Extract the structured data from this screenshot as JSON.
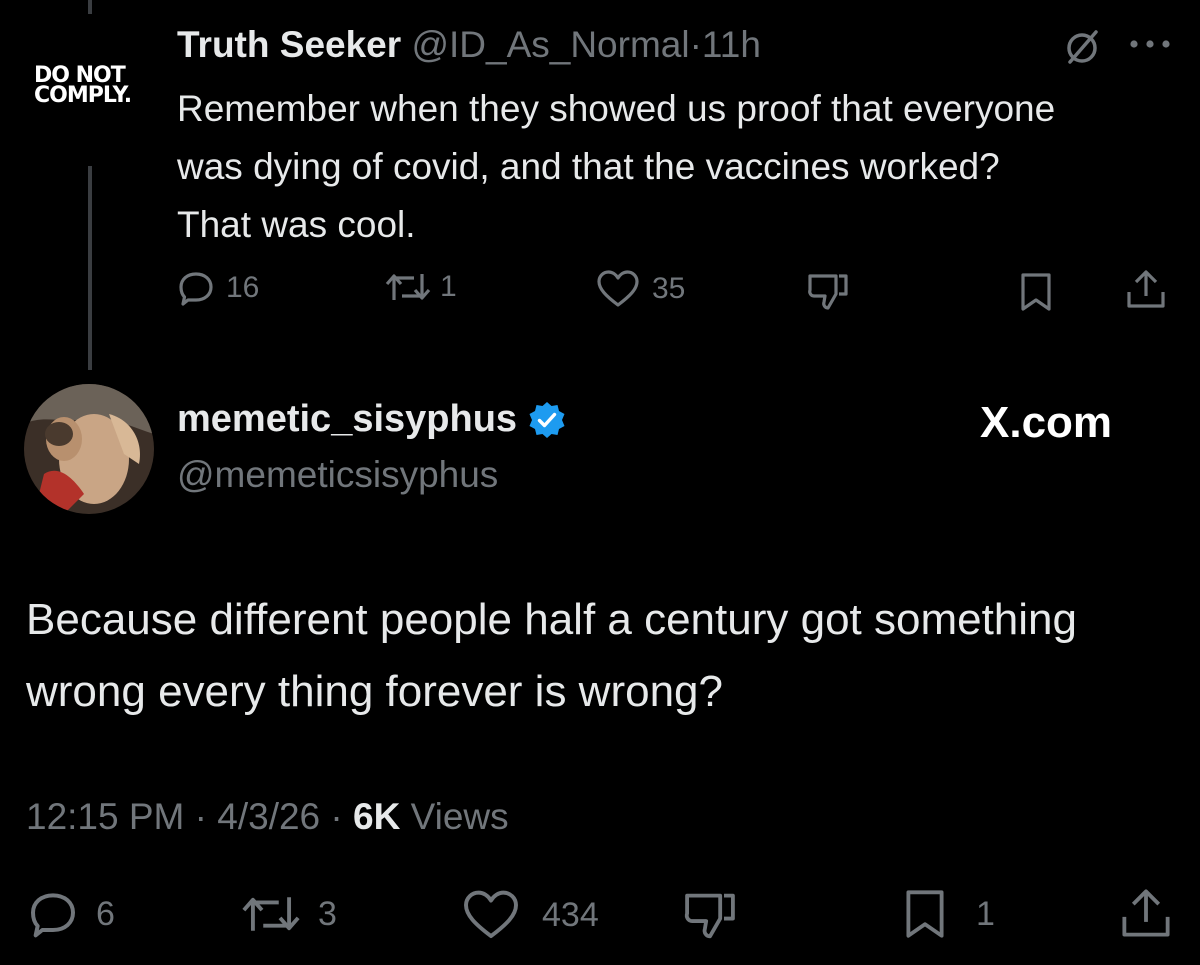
{
  "tweet1": {
    "badge_line1": "DO NOT",
    "badge_line2": "COMPLY.",
    "display_name": "Truth Seeker",
    "handle": "@ID_As_Normal",
    "separator": "·",
    "time": "11h",
    "text": "Remember when they showed us proof that everyone was dying of covid, and that the vaccines worked? That was cool.",
    "actions": {
      "replies": "16",
      "reposts": "1",
      "likes": "35"
    }
  },
  "tweet2": {
    "display_name": "memetic_sisyphus",
    "handle": "@memeticsisyphus",
    "watermark": "X.com",
    "text": "Because different people half a century got something wrong every thing forever is wrong?",
    "time": "12:15 PM",
    "dot": "·",
    "date": "4/3/26",
    "views_count": "6K",
    "views_label": "Views",
    "actions": {
      "replies": "6",
      "reposts": "3",
      "likes": "434",
      "bookmarks": "1"
    }
  },
  "colors": {
    "background": "#000000",
    "text": "#e7e9ea",
    "muted": "#71767b",
    "verified": "#1d9bf0",
    "thread_line": "#3a3d41"
  }
}
